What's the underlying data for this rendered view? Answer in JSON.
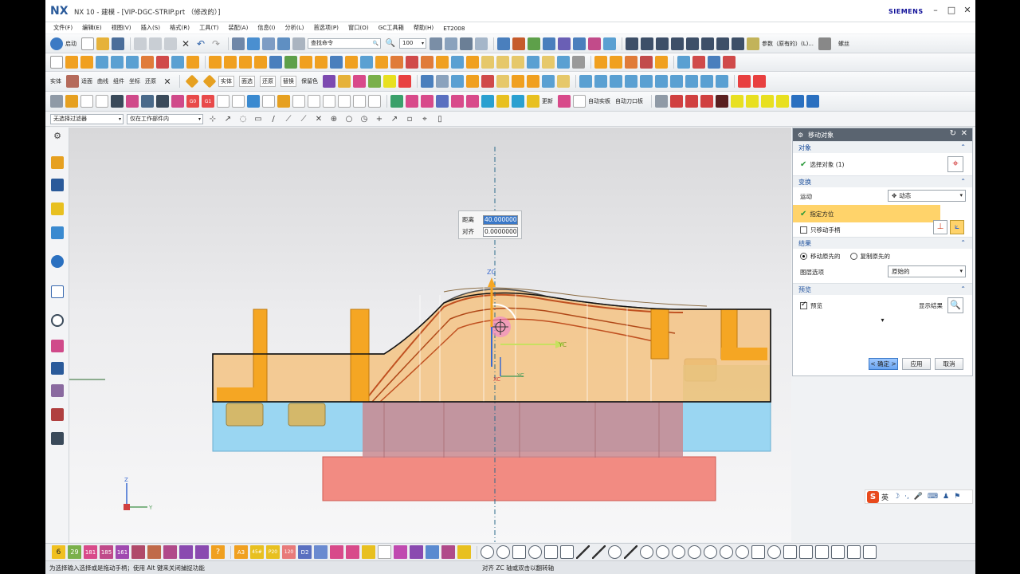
{
  "app": {
    "logo": "NX",
    "title": "NX 10 - 建模 - [VIP-DGC-STRIP.prt （修改的）]",
    "vendor": "SIEMENS"
  },
  "menu": [
    "文件(F)",
    "编辑(E)",
    "视图(V)",
    "插入(S)",
    "格式(R)",
    "工具(T)",
    "装配(A)",
    "信息(I)",
    "分析(L)",
    "首选项(P)",
    "窗口(O)",
    "GC工具箱",
    "帮助(H)",
    "ET2008"
  ],
  "toolbar1": {
    "start_label": "启动",
    "search_placeholder": "查找命令",
    "zoom_value": "100",
    "params_label": "参数（原有的）(L)...",
    "extra_label": "螺丝"
  },
  "toolbar3": {
    "labels": [
      "实体",
      "适面",
      "曲线",
      "组件",
      "坐标",
      "还原"
    ],
    "solid_labels": [
      "实体",
      "面选",
      "还原",
      "替换",
      "保留色"
    ],
    "extra_labels": [
      "实体",
      "面选",
      "还原",
      "替换",
      "保留色",
      "快速",
      "快速"
    ]
  },
  "toolbar4": {
    "labels": [
      "更新",
      "自动实板",
      "自动刀口板"
    ]
  },
  "filterbar": {
    "type_filter": "无选择过滤器",
    "scope_filter": "仅在工作部件内"
  },
  "popup": {
    "distance_label": "距离",
    "distance_value": "40.000000",
    "align_label": "对齐",
    "align_value": "0.0000000"
  },
  "triad": {
    "zc": "ZC",
    "xc": "XC",
    "yc": "YC",
    "yc2": "YC"
  },
  "wcs": {
    "z": "Z",
    "y": "Y"
  },
  "panel": {
    "title": "移动对象",
    "sections": {
      "object": "对象",
      "transform": "变换",
      "result": "结果",
      "preview": "预览"
    },
    "select_object": "选择对象 (1)",
    "motion_label": "运动",
    "motion_value": "动态",
    "specify_orientation": "指定方位",
    "only_move_handle": "只移动手柄",
    "move_original": "移动原先的",
    "copy_original": "复制原先的",
    "layer_option_label": "图层选项",
    "layer_option_value": "原始的",
    "preview_label": "预览",
    "show_result": "显示结果",
    "ok": "< 确定 >",
    "apply": "应用",
    "cancel": "取消",
    "preview_checked": true,
    "only_move_handle_checked": false,
    "move_original_selected": true
  },
  "bottombar": {
    "numbers": [
      "6",
      "29",
      "181",
      "185",
      "161"
    ],
    "codes": [
      "A3",
      "45#",
      "P20",
      "120",
      "D2"
    ]
  },
  "status": {
    "left": "为选择输入选择或是拖动手柄；使用 Alt 键来关闭捕捉功能",
    "middle": "对齐 ZC 轴或双击以翻转轴"
  },
  "ime": {
    "logo": "S",
    "lang": "英"
  },
  "colors": {
    "panel_header": "#5a6470",
    "highlight_row": "#ffd36a",
    "part_orange": "#f5a623",
    "die_red": "#f28b82",
    "plate_blue": "#9ad6f2"
  }
}
